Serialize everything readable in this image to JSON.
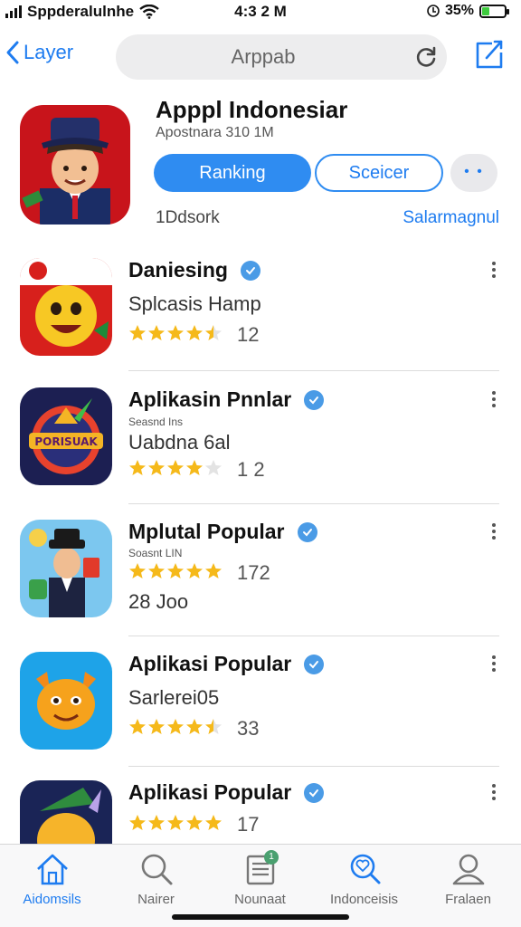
{
  "status_bar": {
    "carrier": "Sppderalulnhe",
    "time": "4:3 2 M",
    "battery": "35%",
    "battery_level": 0.35
  },
  "nav": {
    "back_label": "Layer",
    "search_text": "Arppab"
  },
  "featured": {
    "title": "Apppl Indonesiar",
    "subtitle": "Apostnara 310 1M",
    "primary_button": "Ranking",
    "secondary_button": "Sceicer",
    "more_button": "• •",
    "meta": "1Ddsork",
    "link": "Salarmagnul"
  },
  "apps": [
    {
      "title": "Daniesing",
      "line": "Splcasis Hamp",
      "rating": 4.5,
      "count": "12"
    },
    {
      "title": "Aplikasin Pnnlar",
      "small": "Seasnd Ins",
      "line": "Uabdna  6al",
      "rating": 4.0,
      "count": "1 2"
    },
    {
      "title": "Mplutal Popular",
      "small": "Soasnt LIN",
      "rating": 5,
      "count": "172",
      "line": "28 Joo"
    },
    {
      "title": "Aplikasi Popular",
      "line": "Sarlerei05",
      "rating": 4.5,
      "count": "33"
    },
    {
      "title": "Aplikasi Popular",
      "rating": 5,
      "count": "17",
      "count_display": "17"
    }
  ],
  "tabs": [
    {
      "label": "Aidomsils",
      "icon": "home-icon",
      "active": true
    },
    {
      "label": "Nairer",
      "icon": "search-icon",
      "active": false
    },
    {
      "label": "Nounaat",
      "icon": "news-icon",
      "active": false,
      "badge": "1"
    },
    {
      "label": "Indonceisis",
      "icon": "search-heart-icon",
      "active": false
    },
    {
      "label": "Fralaen",
      "icon": "person-icon",
      "active": false
    }
  ],
  "colors": {
    "accent": "#1e7cf0",
    "star": "#f5b91a",
    "badge": "#4aa070"
  }
}
